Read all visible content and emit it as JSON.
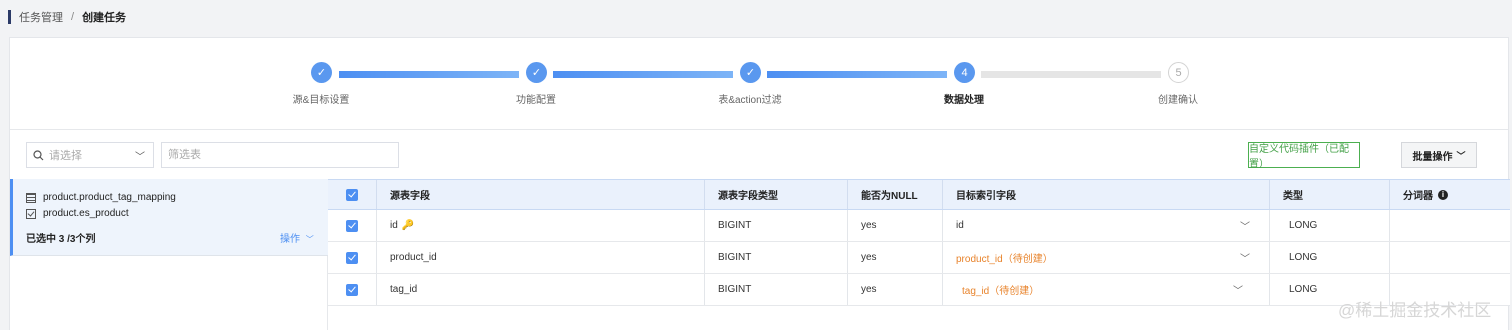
{
  "breadcrumb": {
    "parent": "任务管理",
    "separator": "/",
    "current": "创建任务"
  },
  "steps": [
    {
      "label": "源&目标设置",
      "status": "done",
      "marker": "✓"
    },
    {
      "label": "功能配置",
      "status": "done",
      "marker": "✓"
    },
    {
      "label": "表&action过滤",
      "status": "done",
      "marker": "✓"
    },
    {
      "label": "数据处理",
      "status": "active",
      "marker": "4"
    },
    {
      "label": "创建确认",
      "status": "todo",
      "marker": "5"
    }
  ],
  "toolbar": {
    "select_placeholder": "请选择",
    "filter_placeholder": "筛选表",
    "custom_plugin_label": "自定义代码插件（已配置）",
    "batch_label": "批量操作",
    "colors": {
      "accent": "#4d8ff2",
      "plugin_green": "#43a047"
    }
  },
  "left_panel": {
    "source_table": "product.product_tag_mapping",
    "target_index": "product.es_product",
    "summary": "已选中 3 /3个列",
    "op_label": "操作"
  },
  "table": {
    "headers": {
      "source_field": "源表字段",
      "source_type": "源表字段类型",
      "nullable": "能否为NULL",
      "target_field": "目标索引字段",
      "type": "类型",
      "analyzer": "分词器"
    },
    "rows": [
      {
        "source_field": "id",
        "source_type": "BIGINT",
        "nullable": "yes",
        "target_field": "id",
        "type": "LONG",
        "pending": false
      },
      {
        "source_field": "product_id",
        "source_type": "BIGINT",
        "nullable": "yes",
        "target_field": "product_id（待创建）",
        "type": "LONG",
        "pending": true
      },
      {
        "source_field": "tag_id",
        "source_type": "BIGINT",
        "nullable": "yes",
        "target_field": "tag_id（待创建）",
        "type": "LONG",
        "pending": true
      }
    ]
  },
  "watermark": "@稀土掘金技术社区"
}
